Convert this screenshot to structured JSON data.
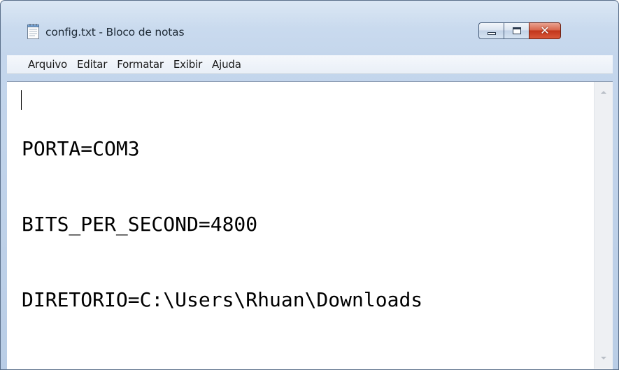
{
  "window": {
    "title": "config.txt - Bloco de notas",
    "app_icon": "notepad-icon",
    "caption_buttons": {
      "minimize_icon": "minimize-icon",
      "maximize_icon": "maximize-icon",
      "close_icon": "close-icon",
      "close_glyph": "✕"
    }
  },
  "menubar": {
    "items": [
      {
        "label": "Arquivo"
      },
      {
        "label": "Editar"
      },
      {
        "label": "Formatar"
      },
      {
        "label": "Exibir"
      },
      {
        "label": "Ajuda"
      }
    ]
  },
  "editor": {
    "lines": [
      "PORTA=COM3",
      "BITS_PER_SECOND=4800",
      "DIRETORIO=C:\\Users\\Rhuan\\Downloads"
    ]
  },
  "colors": {
    "frame": "#c4d6ec",
    "close_button": "#c2351b",
    "text": "#000000",
    "editor_background": "#ffffff"
  }
}
